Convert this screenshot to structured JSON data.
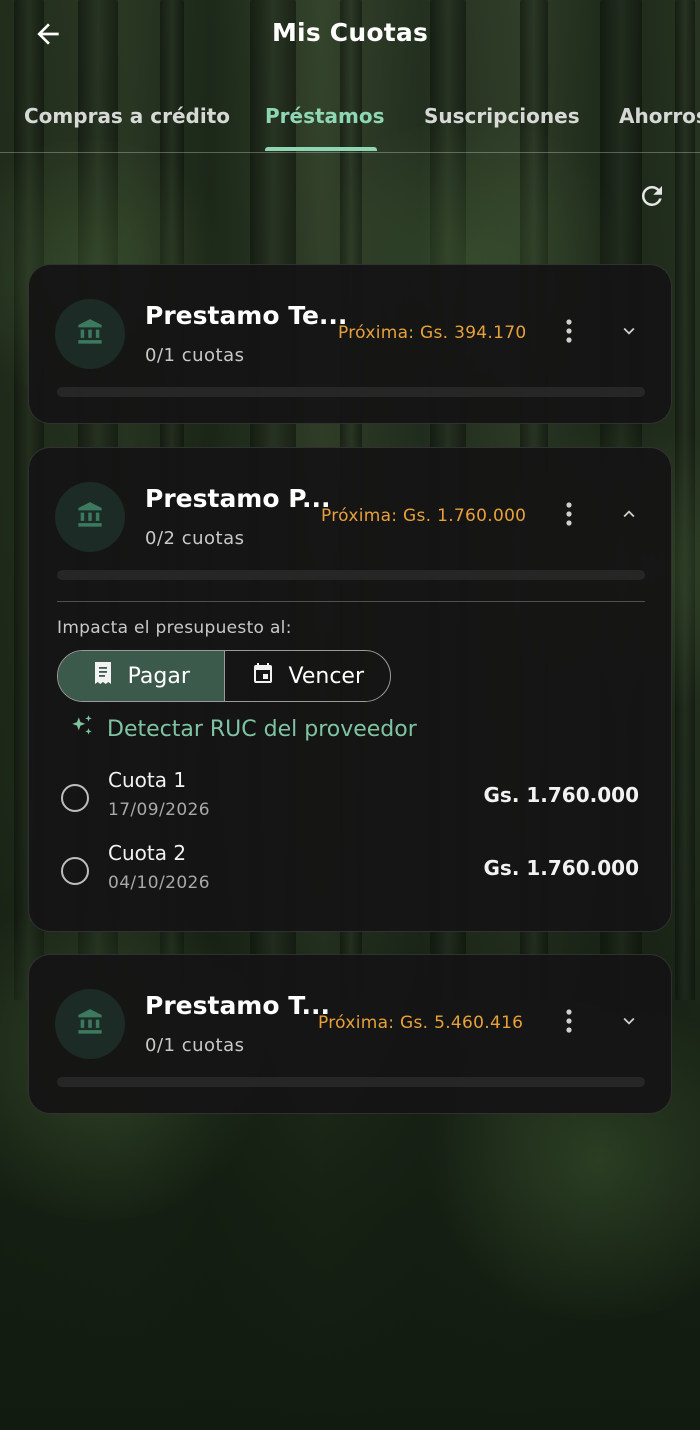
{
  "header": {
    "title": "Mis Cuotas"
  },
  "tabs": [
    {
      "label": "Compras a crédito"
    },
    {
      "label": "Préstamos"
    },
    {
      "label": "Suscripciones"
    },
    {
      "label": "Ahorros"
    }
  ],
  "active_tab": "Préstamos",
  "loans": [
    {
      "title": "Prestamo Te...",
      "cuotas_text": "0/1 cuotas",
      "next_text": "Próxima: Gs. 394.170",
      "expanded": false
    },
    {
      "title": "Prestamo P...",
      "cuotas_text": "0/2 cuotas",
      "next_text": "Próxima: Gs. 1.760.000",
      "expanded": true,
      "impact_label": "Impacta el presupuesto al:",
      "segments": [
        {
          "label": "Pagar",
          "selected": true
        },
        {
          "label": "Vencer",
          "selected": false
        }
      ],
      "detect_label": "Detectar RUC del proveedor",
      "installments": [
        {
          "name": "Cuota 1",
          "date": "17/09/2026",
          "amount": "Gs. 1.760.000"
        },
        {
          "name": "Cuota 2",
          "date": "04/10/2026",
          "amount": "Gs. 1.760.000"
        }
      ]
    },
    {
      "title": "Prestamo T...",
      "cuotas_text": "0/1 cuotas",
      "next_text": "Próxima: Gs. 5.460.416",
      "expanded": false
    }
  ],
  "colors": {
    "accent": "#8fd6b4",
    "next_amount": "#e8a13a",
    "card_bg": "#141414",
    "selected_segment": "#3c5a4b"
  },
  "icons": {
    "back": "arrow-left-icon",
    "refresh": "refresh-icon",
    "bank": "bank-icon",
    "more": "more-vertical-icon",
    "expand": "chevron-down-icon",
    "collapse": "chevron-up-icon",
    "pay": "receipt-icon",
    "due": "calendar-icon",
    "detect": "sparkle-icon"
  }
}
